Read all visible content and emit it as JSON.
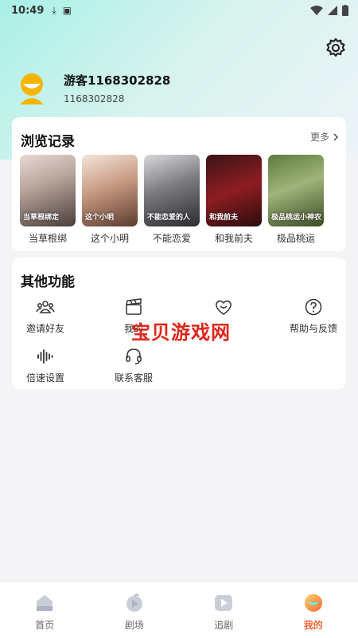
{
  "status_bar": {
    "time": "10:49"
  },
  "profile": {
    "username": "游客1168302828",
    "user_id": "1168302828"
  },
  "history": {
    "title": "浏览记录",
    "more_label": "更多",
    "items": [
      {
        "title": "当草根绑",
        "poster_text": "当草根绑定"
      },
      {
        "title": "这个小明",
        "poster_text": "这个小明"
      },
      {
        "title": "不能恋爱",
        "poster_text": "不能恋爱的人"
      },
      {
        "title": "和我前夫",
        "poster_text": "和我前夫"
      },
      {
        "title": "极品桃运",
        "poster_text": "极品桃运小神农"
      }
    ]
  },
  "functions": {
    "title": "其他功能",
    "items": [
      {
        "label": "邀请好友",
        "icon": "people-icon"
      },
      {
        "label": "我的",
        "icon": "clapperboard-icon"
      },
      {
        "label": "",
        "icon": "smile-heart-icon"
      },
      {
        "label": "帮助与反馈",
        "icon": "help-icon"
      },
      {
        "label": "倍速设置",
        "icon": "soundwave-icon"
      },
      {
        "label": "联系客服",
        "icon": "headset-icon"
      }
    ]
  },
  "watermark": "宝贝游戏网",
  "tabbar": {
    "items": [
      {
        "label": "首页",
        "icon": "home-icon"
      },
      {
        "label": "剧场",
        "icon": "theater-icon"
      },
      {
        "label": "追剧",
        "icon": "play-icon"
      },
      {
        "label": "我的",
        "icon": "profile-icon"
      }
    ],
    "active_index": 3
  },
  "colors": {
    "accent": "#f26a3a",
    "avatar": "#f5b400",
    "watermark": "#e0261b"
  }
}
